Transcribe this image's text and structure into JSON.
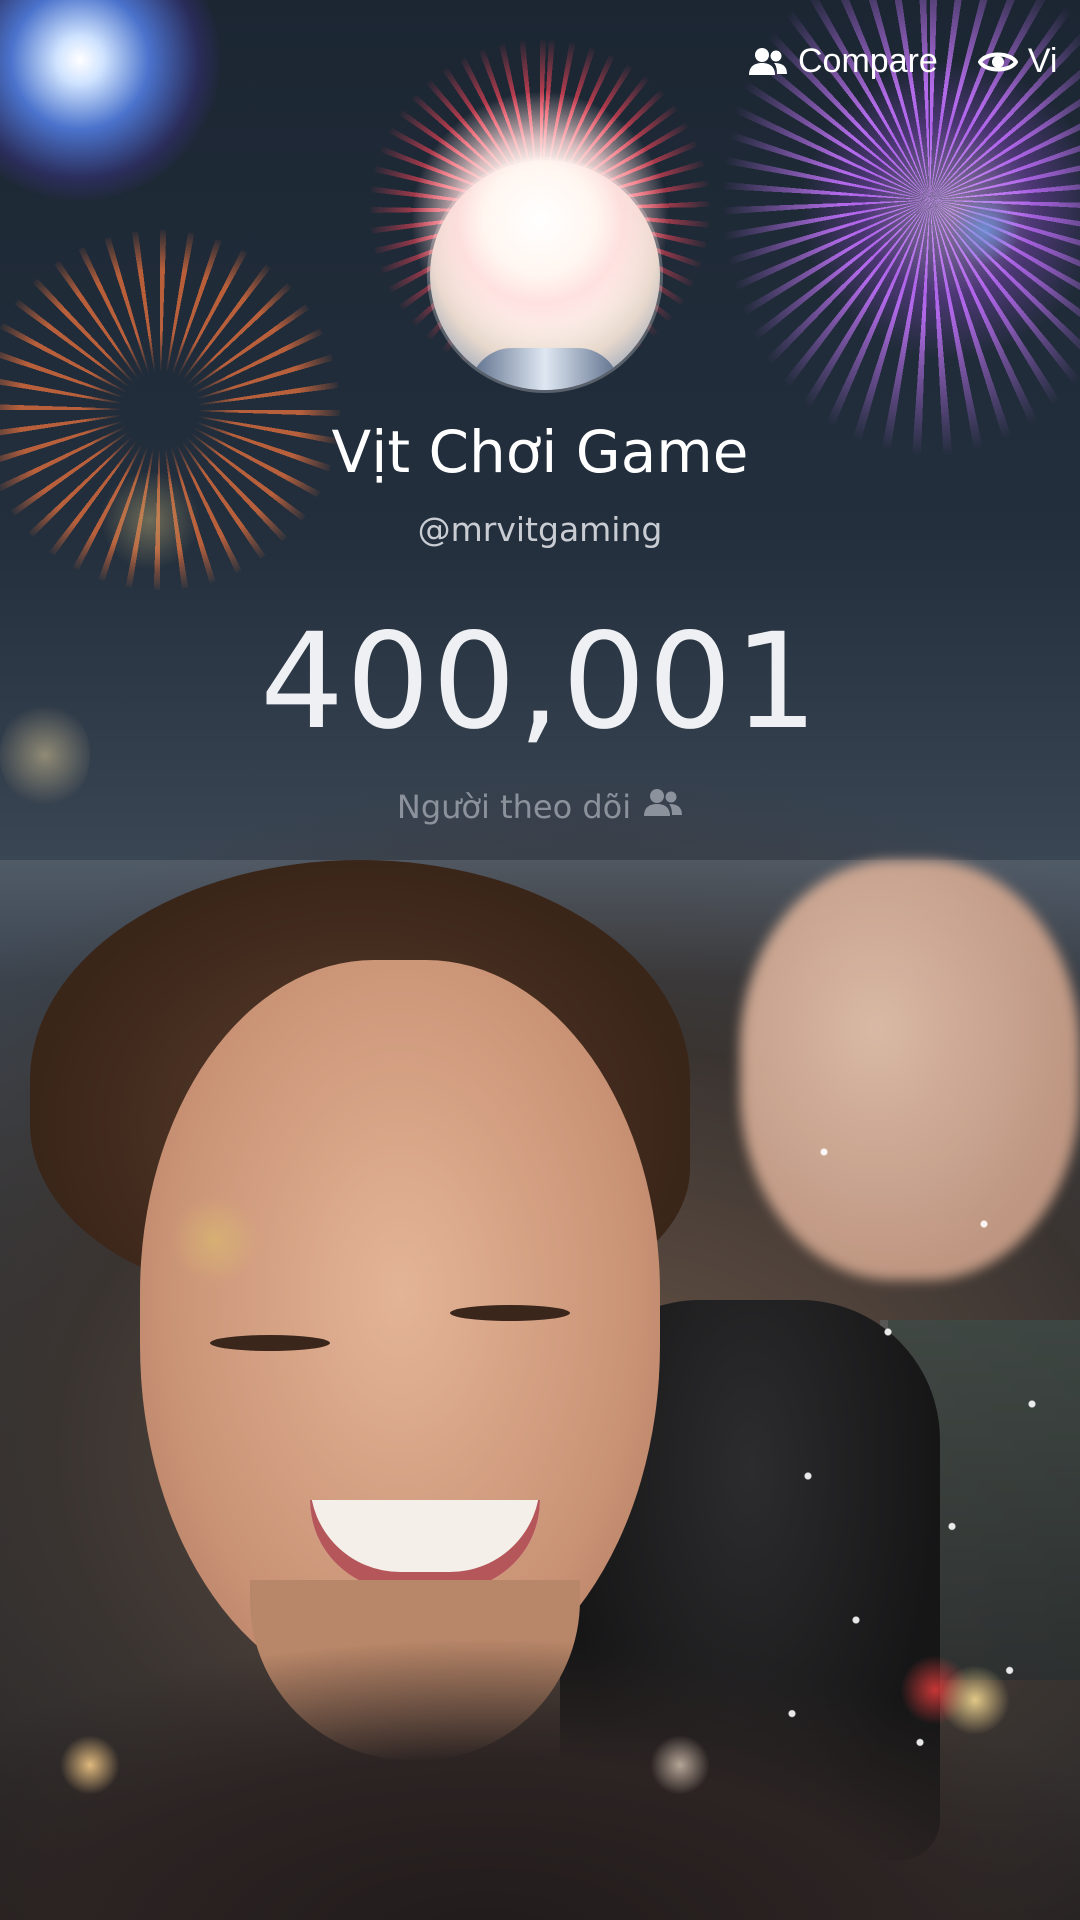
{
  "nav": {
    "compare_label": "Compare",
    "view_label": "Vi",
    "compare_icon": "users-icon",
    "view_icon": "eye-icon"
  },
  "profile": {
    "display_name": "Vịt Chơi Game",
    "username": "@mrvitgaming",
    "follower_count": "400,001",
    "follower_label": "Người theo dõi",
    "follower_icon": "users-icon"
  },
  "colors": {
    "background_top": "#1c2633",
    "text_primary": "#ffffff",
    "text_secondary": "#c9cdd3",
    "text_muted": "#8e949c"
  }
}
